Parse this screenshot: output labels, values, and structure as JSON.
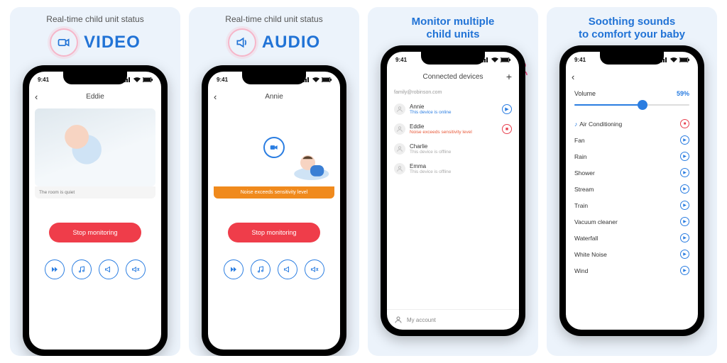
{
  "time": "9:41",
  "panels": {
    "video": {
      "subtitle": "Real-time child unit status",
      "mode": "VIDEO",
      "child_name": "Eddie",
      "status_text": "The room is quiet",
      "stop_label": "Stop monitoring"
    },
    "audio": {
      "subtitle": "Real-time child unit status",
      "mode": "AUDIO",
      "child_name": "Annie",
      "status_text": "Noise exceeds sensitivity level",
      "stop_label": "Stop monitoring"
    },
    "devices": {
      "title": "Monitor multiple\nchild units",
      "header": "Connected devices",
      "email": "family@robinson.com",
      "items": [
        {
          "name": "Annie",
          "status": "This device is online",
          "status_cls": "green",
          "action": "play"
        },
        {
          "name": "Eddie",
          "status": "Noise exceeds sensitivity level",
          "status_cls": "red",
          "action": "stop"
        },
        {
          "name": "Charlie",
          "status": "This device is offline",
          "status_cls": "grey",
          "action": ""
        },
        {
          "name": "Emma",
          "status": "This device is offline",
          "status_cls": "grey",
          "action": ""
        }
      ],
      "account_label": "My account"
    },
    "sounds": {
      "title": "Soothing sounds\nto comfort your baby",
      "volume_label": "Volume",
      "volume_value": "59%",
      "volume_pct": 59,
      "items": [
        {
          "name": "Air Conditioning",
          "playing": true
        },
        {
          "name": "Fan",
          "playing": false
        },
        {
          "name": "Rain",
          "playing": false
        },
        {
          "name": "Shower",
          "playing": false
        },
        {
          "name": "Stream",
          "playing": false
        },
        {
          "name": "Train",
          "playing": false
        },
        {
          "name": "Vacuum cleaner",
          "playing": false
        },
        {
          "name": "Waterfall",
          "playing": false
        },
        {
          "name": "White Noise",
          "playing": false
        },
        {
          "name": "Wind",
          "playing": false
        }
      ]
    }
  }
}
